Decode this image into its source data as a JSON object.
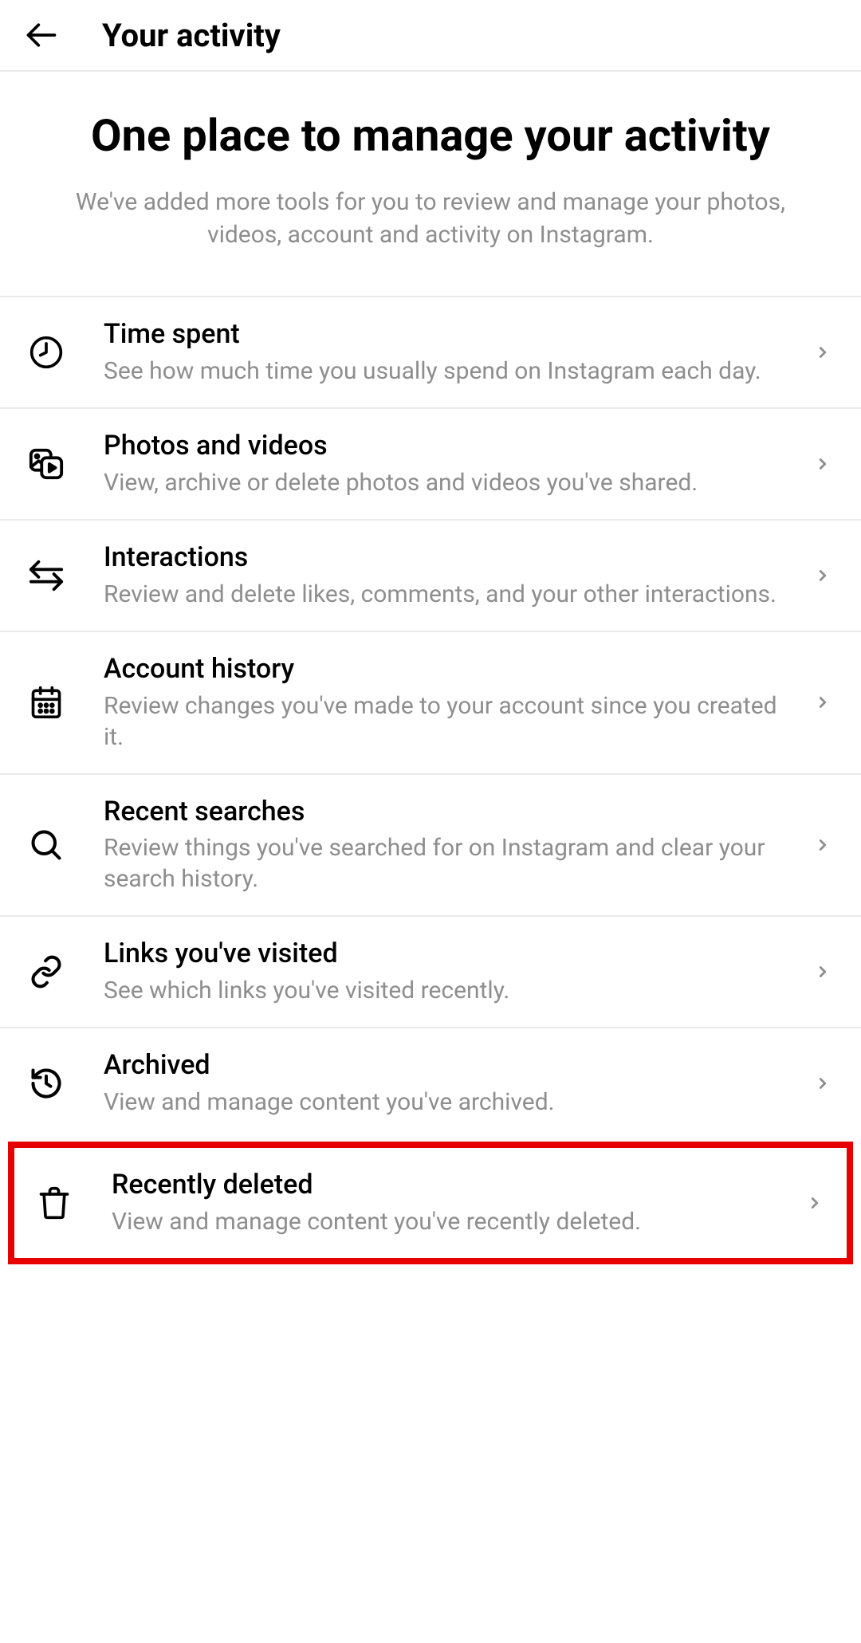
{
  "header": {
    "title": "Your activity"
  },
  "hero": {
    "title": "One place to manage your activity",
    "subtitle": "We've added more tools for you to review and manage your photos, videos, account and activity on Instagram."
  },
  "items": [
    {
      "key": "time-spent",
      "icon": "clock-icon",
      "title": "Time spent",
      "desc": "See how much time you usually spend on Instagram each day."
    },
    {
      "key": "photos-videos",
      "icon": "media-icon",
      "title": "Photos and videos",
      "desc": "View, archive or delete photos and videos you've shared."
    },
    {
      "key": "interactions",
      "icon": "arrows-icon",
      "title": "Interactions",
      "desc": "Review and delete likes, comments, and your other interactions."
    },
    {
      "key": "account-history",
      "icon": "calendar-icon",
      "title": "Account history",
      "desc": "Review changes you've made to your account since you created it."
    },
    {
      "key": "recent-searches",
      "icon": "search-icon",
      "title": "Recent searches",
      "desc": "Review things you've searched for on Instagram and clear your search history."
    },
    {
      "key": "links-visited",
      "icon": "link-icon",
      "title": "Links you've visited",
      "desc": "See which links you've visited recently."
    },
    {
      "key": "archived",
      "icon": "history-icon",
      "title": "Archived",
      "desc": "View and manage content you've archived."
    },
    {
      "key": "recently-deleted",
      "icon": "trash-icon",
      "title": "Recently deleted",
      "desc": "View and manage content you've recently deleted."
    }
  ]
}
